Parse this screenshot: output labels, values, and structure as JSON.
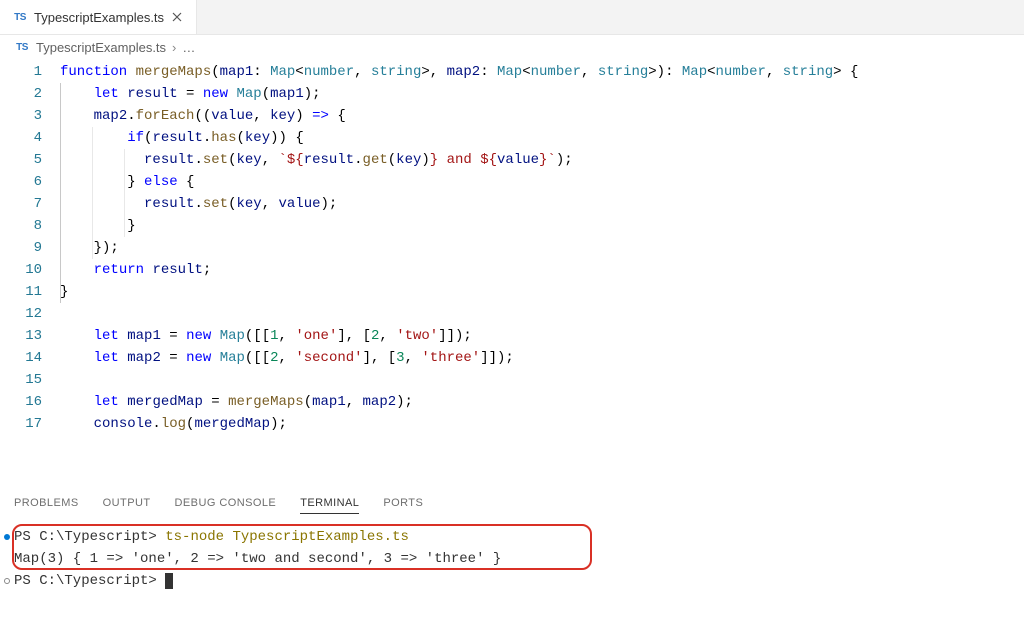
{
  "tab": {
    "icon": "TS",
    "title": "TypescriptExamples.ts"
  },
  "breadcrumb": {
    "icon": "TS",
    "file": "TypescriptExamples.ts",
    "chevron": "›",
    "more": "…"
  },
  "code": {
    "lines": [
      {
        "n": "1",
        "ind": 0,
        "guides": [],
        "tokens": [
          [
            "kw",
            "function "
          ],
          [
            "fn",
            "mergeMaps"
          ],
          [
            "punc",
            "("
          ],
          [
            "var",
            "map1"
          ],
          [
            "punc",
            ": "
          ],
          [
            "type",
            "Map"
          ],
          [
            "punc",
            "<"
          ],
          [
            "type",
            "number"
          ],
          [
            "punc",
            ", "
          ],
          [
            "type",
            "string"
          ],
          [
            "punc",
            ">, "
          ],
          [
            "var",
            "map2"
          ],
          [
            "punc",
            ": "
          ],
          [
            "type",
            "Map"
          ],
          [
            "punc",
            "<"
          ],
          [
            "type",
            "number"
          ],
          [
            "punc",
            ", "
          ],
          [
            "type",
            "string"
          ],
          [
            "punc",
            ">): "
          ],
          [
            "type",
            "Map"
          ],
          [
            "punc",
            "<"
          ],
          [
            "type",
            "number"
          ],
          [
            "punc",
            ", "
          ],
          [
            "type",
            "string"
          ],
          [
            "punc",
            "> {"
          ]
        ]
      },
      {
        "n": "2",
        "ind": 4,
        "guides": [
          1
        ],
        "tokens": [
          [
            "kw",
            "let"
          ],
          [
            "punc",
            " "
          ],
          [
            "var",
            "result"
          ],
          [
            "punc",
            " = "
          ],
          [
            "kw",
            "new"
          ],
          [
            "punc",
            " "
          ],
          [
            "type",
            "Map"
          ],
          [
            "punc",
            "("
          ],
          [
            "var",
            "map1"
          ],
          [
            "punc",
            ");"
          ]
        ]
      },
      {
        "n": "3",
        "ind": 4,
        "guides": [
          1
        ],
        "tokens": [
          [
            "var",
            "map2"
          ],
          [
            "punc",
            "."
          ],
          [
            "fn",
            "forEach"
          ],
          [
            "punc",
            "(("
          ],
          [
            "var",
            "value"
          ],
          [
            "punc",
            ", "
          ],
          [
            "var",
            "key"
          ],
          [
            "punc",
            ") "
          ],
          [
            "kw",
            "=>"
          ],
          [
            "punc",
            " {"
          ]
        ]
      },
      {
        "n": "4",
        "ind": 8,
        "guides": [
          1,
          2
        ],
        "tokens": [
          [
            "kw",
            "if"
          ],
          [
            "punc",
            "("
          ],
          [
            "var",
            "result"
          ],
          [
            "punc",
            "."
          ],
          [
            "fn",
            "has"
          ],
          [
            "punc",
            "("
          ],
          [
            "var",
            "key"
          ],
          [
            "punc",
            ")) {"
          ]
        ]
      },
      {
        "n": "5",
        "ind": 10,
        "guides": [
          1,
          2,
          3
        ],
        "tokens": [
          [
            "var",
            "result"
          ],
          [
            "punc",
            "."
          ],
          [
            "fn",
            "set"
          ],
          [
            "punc",
            "("
          ],
          [
            "var",
            "key"
          ],
          [
            "punc",
            ", "
          ],
          [
            "str",
            "`${"
          ],
          [
            "var",
            "result"
          ],
          [
            "punc",
            "."
          ],
          [
            "fn",
            "get"
          ],
          [
            "punc",
            "("
          ],
          [
            "var",
            "key"
          ],
          [
            "punc",
            ")"
          ],
          [
            "str",
            "} and ${"
          ],
          [
            "var",
            "value"
          ],
          [
            "str",
            "}`"
          ],
          [
            "punc",
            ");"
          ]
        ]
      },
      {
        "n": "6",
        "ind": 8,
        "guides": [
          1,
          2,
          3
        ],
        "tokens": [
          [
            "punc",
            "} "
          ],
          [
            "kw",
            "else"
          ],
          [
            "punc",
            " {"
          ]
        ]
      },
      {
        "n": "7",
        "ind": 10,
        "guides": [
          1,
          2,
          3
        ],
        "tokens": [
          [
            "var",
            "result"
          ],
          [
            "punc",
            "."
          ],
          [
            "fn",
            "set"
          ],
          [
            "punc",
            "("
          ],
          [
            "var",
            "key"
          ],
          [
            "punc",
            ", "
          ],
          [
            "var",
            "value"
          ],
          [
            "punc",
            ");"
          ]
        ]
      },
      {
        "n": "8",
        "ind": 8,
        "guides": [
          1,
          2,
          3
        ],
        "tokens": [
          [
            "punc",
            "}"
          ]
        ]
      },
      {
        "n": "9",
        "ind": 4,
        "guides": [
          1,
          2
        ],
        "tokens": [
          [
            "punc",
            "});"
          ]
        ]
      },
      {
        "n": "10",
        "ind": 4,
        "guides": [
          1
        ],
        "tokens": [
          [
            "kw",
            "return"
          ],
          [
            "punc",
            " "
          ],
          [
            "var",
            "result"
          ],
          [
            "punc",
            ";"
          ]
        ]
      },
      {
        "n": "11",
        "ind": 0,
        "guides": [
          1
        ],
        "tokens": [
          [
            "punc",
            "}"
          ]
        ]
      },
      {
        "n": "12",
        "ind": 0,
        "guides": [],
        "tokens": []
      },
      {
        "n": "13",
        "ind": 4,
        "guides": [],
        "tokens": [
          [
            "kw",
            "let"
          ],
          [
            "punc",
            " "
          ],
          [
            "var",
            "map1"
          ],
          [
            "punc",
            " = "
          ],
          [
            "kw",
            "new"
          ],
          [
            "punc",
            " "
          ],
          [
            "type",
            "Map"
          ],
          [
            "punc",
            "([["
          ],
          [
            "num",
            "1"
          ],
          [
            "punc",
            ", "
          ],
          [
            "str",
            "'one'"
          ],
          [
            "punc",
            "], ["
          ],
          [
            "num",
            "2"
          ],
          [
            "punc",
            ", "
          ],
          [
            "str",
            "'two'"
          ],
          [
            "punc",
            "]]);"
          ]
        ]
      },
      {
        "n": "14",
        "ind": 4,
        "guides": [],
        "tokens": [
          [
            "kw",
            "let"
          ],
          [
            "punc",
            " "
          ],
          [
            "var",
            "map2"
          ],
          [
            "punc",
            " = "
          ],
          [
            "kw",
            "new"
          ],
          [
            "punc",
            " "
          ],
          [
            "type",
            "Map"
          ],
          [
            "punc",
            "([["
          ],
          [
            "num",
            "2"
          ],
          [
            "punc",
            ", "
          ],
          [
            "str",
            "'second'"
          ],
          [
            "punc",
            "], ["
          ],
          [
            "num",
            "3"
          ],
          [
            "punc",
            ", "
          ],
          [
            "str",
            "'three'"
          ],
          [
            "punc",
            "]]);"
          ]
        ]
      },
      {
        "n": "15",
        "ind": 0,
        "guides": [],
        "tokens": []
      },
      {
        "n": "16",
        "ind": 4,
        "guides": [],
        "tokens": [
          [
            "kw",
            "let"
          ],
          [
            "punc",
            " "
          ],
          [
            "var",
            "mergedMap"
          ],
          [
            "punc",
            " = "
          ],
          [
            "fn",
            "mergeMaps"
          ],
          [
            "punc",
            "("
          ],
          [
            "var",
            "map1"
          ],
          [
            "punc",
            ", "
          ],
          [
            "var",
            "map2"
          ],
          [
            "punc",
            ");"
          ]
        ]
      },
      {
        "n": "17",
        "ind": 4,
        "guides": [],
        "tokens": [
          [
            "var",
            "console"
          ],
          [
            "punc",
            "."
          ],
          [
            "fn",
            "log"
          ],
          [
            "punc",
            "("
          ],
          [
            "var",
            "mergedMap"
          ],
          [
            "punc",
            ");"
          ]
        ]
      }
    ]
  },
  "panel": {
    "tabs": {
      "problems": "PROBLEMS",
      "output": "OUTPUT",
      "debug": "DEBUG CONSOLE",
      "terminal": "TERMINAL",
      "ports": "PORTS"
    }
  },
  "terminal": {
    "line1_prompt": "PS C:\\Typescript> ",
    "line1_cmd": "ts-node TypescriptExamples.ts",
    "line2": "Map(3) { 1 => 'one', 2 => 'two and second', 3 => 'three' }",
    "line3_prompt": "PS C:\\Typescript> "
  }
}
